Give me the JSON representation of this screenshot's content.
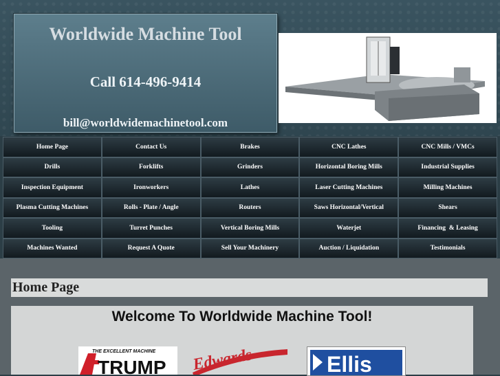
{
  "header": {
    "company": "Worldwide Machine Tool",
    "phone": "Call 614-496-9414",
    "email": "bill@worldwidemachinetool.com"
  },
  "nav": {
    "items": [
      "Home Page",
      "Contact Us",
      "Brakes",
      "CNC Lathes",
      "CNC Mills / VMCs",
      "Drills",
      "Forklifts",
      "Grinders",
      "Horizontal Boring Mills",
      "Industrial Supplies",
      "Inspection Equipment",
      "Ironworkers",
      "Lathes",
      "Laser Cutting Machines",
      "Milling Machines",
      "Plasma Cutting Machines",
      "Rolls - Plate / Angle",
      "Routers",
      "Saws Horizontal/Vertical",
      "Shears",
      "Tooling",
      "Turret Punches",
      "Vertical Boring Mills",
      "Waterjet",
      "Financing  & Leasing",
      "Machines Wanted",
      "Request A Quote",
      "Sell Your Machinery",
      "Auction / Liquidation",
      "Testimonials"
    ]
  },
  "main": {
    "page_title": "Home Page",
    "welcome": "Welcome To Worldwide Machine Tool!"
  },
  "logos": {
    "trump": {
      "tagline": "THE EXCELLENT MACHINE",
      "name": "TRUMP"
    },
    "edwards": {
      "name": "Edwards"
    },
    "ellis": {
      "name": "Ellis"
    }
  },
  "colors": {
    "header_bg": "#2f4650",
    "nav_bg": "#1a2329",
    "trump_red": "#d0202a",
    "ellis_blue": "#1f4fa0"
  }
}
